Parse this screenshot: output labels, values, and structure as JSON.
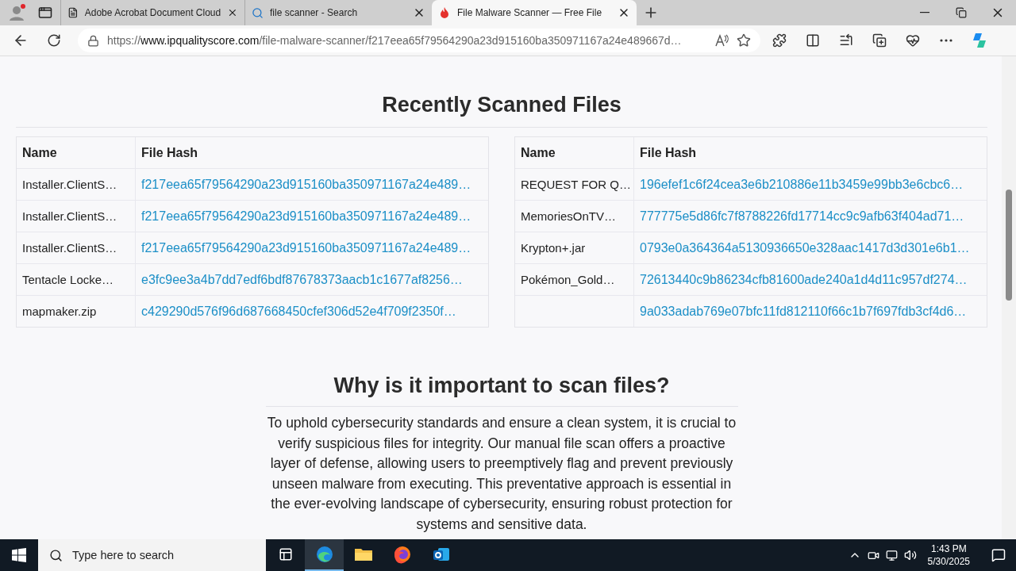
{
  "browser": {
    "tabs": [
      {
        "title": "Adobe Acrobat Document Cloud",
        "kind": "doc",
        "selected": false
      },
      {
        "title": "file scanner - Search",
        "kind": "search",
        "selected": false
      },
      {
        "title": "File Malware Scanner — Free File",
        "kind": "site",
        "selected": true
      }
    ],
    "url": "https://www.ipqualityscore.com/file-malware-scanner/f217eea65f79564290a23d915160ba350971167a24e489667d…"
  },
  "recent": {
    "title": "Recently Scanned Files",
    "tables": [
      {
        "columns": [
          "Name",
          "File Hash"
        ],
        "rows": [
          {
            "name": "Installer.ClientS…",
            "hash": "f217eea65f79564290a23d915160ba350971167a24e489…"
          },
          {
            "name": "Installer.ClientS…",
            "hash": "f217eea65f79564290a23d915160ba350971167a24e489…"
          },
          {
            "name": "Installer.ClientS…",
            "hash": "f217eea65f79564290a23d915160ba350971167a24e489…"
          },
          {
            "name": "Tentacle Locke…",
            "hash": "e3fc9ee3a4b7dd7edf6bdf87678373aacb1c1677af8256…"
          },
          {
            "name": "mapmaker.zip",
            "hash": "c429290d576f96d687668450cfef306d52e4f709f2350f…"
          }
        ]
      },
      {
        "columns": [
          "Name",
          "File Hash"
        ],
        "rows": [
          {
            "name": "REQUEST FOR Q…",
            "hash": "196efef1c6f24cea3e6b210886e11b3459e99bb3e6cbc6…"
          },
          {
            "name": "MemoriesOnTV…",
            "hash": "777775e5d86fc7f8788226fd17714cc9c9afb63f404ad71…"
          },
          {
            "name": "Krypton+.jar",
            "hash": "0793e0a364364a5130936650e328aac1417d3d301e6b1…"
          },
          {
            "name": "Pokémon_Gold…",
            "hash": "72613440c9b86234cfb81600ade240a1d4d11c957df274…"
          },
          {
            "hash": "9a033adab769e07bfc11fd812110f66c1b7f697fdb3cf4d6…"
          }
        ]
      }
    ]
  },
  "why": {
    "title": "Why is it important to scan files?",
    "paragraph": "To uphold cybersecurity standards and ensure a clean system, it is crucial to verify suspicious files for integrity. Our manual file scan offers a proactive layer of defense, allowing users to preemptively flag and prevent previously unseen malware from executing. This preventative approach is essential in the ever-evolving landscape of cybersecurity, ensuring robust protection for systems and sensitive data."
  },
  "taskbar": {
    "search_placeholder": "Type here to search",
    "apps": [
      {
        "kind": "taskview",
        "selected": false
      },
      {
        "kind": "edge",
        "selected": true
      },
      {
        "kind": "explorer",
        "selected": false
      },
      {
        "kind": "firefox",
        "selected": false
      },
      {
        "kind": "outlook",
        "selected": false
      }
    ],
    "time": "1:43 PM",
    "date": "5/30/2025"
  }
}
